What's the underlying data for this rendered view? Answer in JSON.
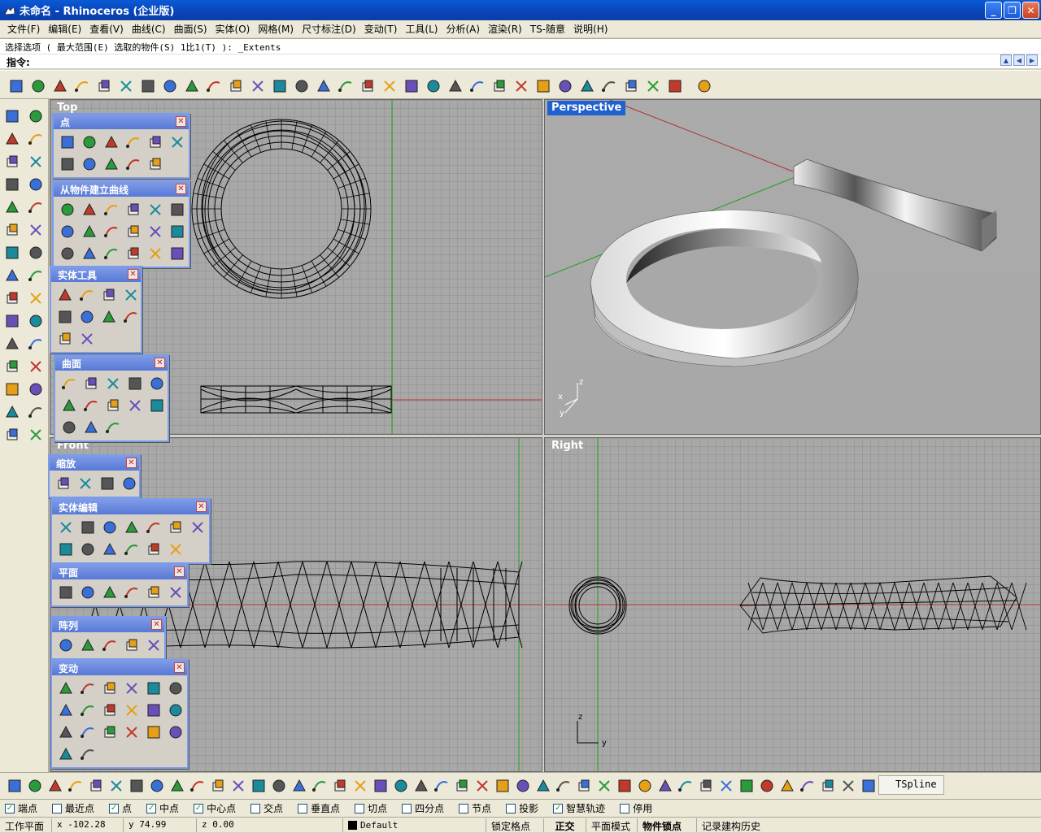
{
  "window": {
    "title": "未命名 - Rhinoceros (企业版)"
  },
  "menu": [
    "文件(F)",
    "编辑(E)",
    "查看(V)",
    "曲线(C)",
    "曲面(S)",
    "实体(O)",
    "网格(M)",
    "尺寸标注(D)",
    "变动(T)",
    "工具(L)",
    "分析(A)",
    "渲染(R)",
    "TS-随意",
    "说明(H)"
  ],
  "command": {
    "history": "选择选项 ( 最大范围(E)  选取的物件(S)  1比1(T) ): _Extents",
    "prompt": "指令:"
  },
  "main_toolbar_icons": [
    "new-icon",
    "open-icon",
    "save-icon",
    "print-icon",
    "import-icon",
    "cut-icon",
    "copy-icon",
    "paste-icon",
    "undo-icon",
    "pan-hand-icon",
    "rotate-view-icon",
    "zoom-icon",
    "zoom-window-icon",
    "zoom-extents-icon",
    "zoom-selected-icon",
    "undo-view-icon",
    "four-viewports-icon",
    "car-icon",
    "grid-icon",
    "osnap-icon",
    "cplane-icon",
    "light-icon",
    "layer-icon",
    "color-wheel-icon",
    "render-sphere-icon",
    "wire-sphere-icon",
    "shaded-sphere-icon",
    "analyze-icon",
    "options-gear-icon",
    "snap-grid-icon",
    "help-icon",
    "grasshopper-icon"
  ],
  "viewports": {
    "top": "Top",
    "perspective": "Perspective",
    "front": "Front",
    "right": "Right"
  },
  "palettes": [
    {
      "title": "点",
      "icons": [
        "point-icon",
        "point-cloud-icon",
        "point-grid-icon",
        "curve-points-icon",
        "divide-curve-icon",
        "divide-length-icon",
        "polyline-points-icon",
        "point-array-icon",
        "dense-points-icon",
        "scatter-points-icon",
        "extract-points-icon"
      ]
    },
    {
      "title": "从物件建立曲线",
      "icons": [
        "project-icon",
        "pull-icon",
        "duplicate-edge-icon",
        "duplicate-border-icon",
        "contour-icon",
        "section-icon",
        "silhouette-icon",
        "intersect-icon",
        "offset-surface-icon",
        "isocurve-icon",
        "wireframe-icon",
        "dup-mesh-edge-icon",
        "mesh-outline-icon",
        "points-curve-icon",
        "unroll-icon",
        "create-uv-icon",
        "flow-icon",
        "paint-brush-icon"
      ]
    },
    {
      "title": "实体工具",
      "icons": [
        "boolean-union-icon",
        "boolean-difference-icon",
        "boolean-intersection-icon",
        "boolean-split-icon",
        "cap-icon",
        "extract-surface-icon",
        "merge-faces-icon",
        "shell-icon",
        "fillet-edge-icon",
        "chamfer-edge-icon"
      ]
    },
    {
      "title": "曲面",
      "icons": [
        "surface-corners-icon",
        "surface-edges-icon",
        "surface-planar-icon",
        "extrude-surface-icon",
        "loft-icon",
        "rail-revolve-icon",
        "sweep-one-icon",
        "sweep-two-icon",
        "network-srf-icon",
        "patch-icon",
        "drape-icon",
        "heightfield-icon",
        "point-grid-srf-icon"
      ]
    },
    {
      "title": "缩放",
      "icons": [
        "scale-3d-icon",
        "scale-2d-icon",
        "scale-1d-icon",
        "scale-nu-icon"
      ]
    },
    {
      "title": "实体编辑",
      "icons": [
        "move-face-icon",
        "move-edge-icon",
        "split-face-icon",
        "fold-face-icon",
        "extrude-face-icon",
        "move-hole-icon",
        "rotate-hole-icon",
        "copy-hole-icon",
        "array-hole-icon",
        "delete-hole-icon",
        "make-hole-icon",
        "place-hole-icon",
        "box-edit-icon"
      ]
    },
    {
      "title": "平面",
      "icons": [
        "plane-corner-icon",
        "plane-3pt-icon",
        "plane-vertical-icon",
        "plane-fit-icon",
        "cutting-plane-icon",
        "picture-frame-icon"
      ]
    },
    {
      "title": "阵列",
      "icons": [
        "array-rect-icon",
        "array-polar-icon",
        "array-curve-icon",
        "array-srf-icon",
        "array-crv-on-srf-icon"
      ]
    },
    {
      "title": "变动",
      "icons": [
        "move-icon",
        "rotate-icon",
        "copy-array-icon",
        "flow-along-icon",
        "cage-edit-icon",
        "align-icon",
        "orient-icon",
        "twist-icon",
        "bend-icon",
        "array-grid-icon",
        "set-points-icon",
        "smash-icon",
        "smooth-icon",
        "taper-icon",
        "shear-icon",
        "mirror-icon",
        "stretch-icon",
        "splop-icon",
        "maelstrom-icon",
        "sporph-icon"
      ]
    }
  ],
  "bottom_toolbar_label": "TSpline",
  "snaps": [
    {
      "label": "端点",
      "checked": true
    },
    {
      "label": "最近点",
      "checked": false
    },
    {
      "label": "点",
      "checked": true
    },
    {
      "label": "中点",
      "checked": true
    },
    {
      "label": "中心点",
      "checked": true
    },
    {
      "label": "交点",
      "checked": false
    },
    {
      "label": "垂直点",
      "checked": false
    },
    {
      "label": "切点",
      "checked": false
    },
    {
      "label": "四分点",
      "checked": false
    },
    {
      "label": "节点",
      "checked": false
    },
    {
      "label": "投影",
      "checked": false
    },
    {
      "label": "智慧轨迹",
      "checked": true
    },
    {
      "label": "停用",
      "checked": false
    }
  ],
  "status": {
    "cplane": "工作平面",
    "x": "x -102.28",
    "y": "y 74.99",
    "z": "z 0.00",
    "layer": "Default",
    "grid_snap": "锁定格点",
    "ortho": "正交",
    "planar": "平面模式",
    "osnap": "物件锁点",
    "history": "记录建构历史"
  },
  "colors": {
    "titlebar": "#0843b8",
    "viewport_bg": "#a8a8a8",
    "active_title": "#2060d0",
    "x_axis": "#c03030",
    "y_axis": "#20a020"
  }
}
